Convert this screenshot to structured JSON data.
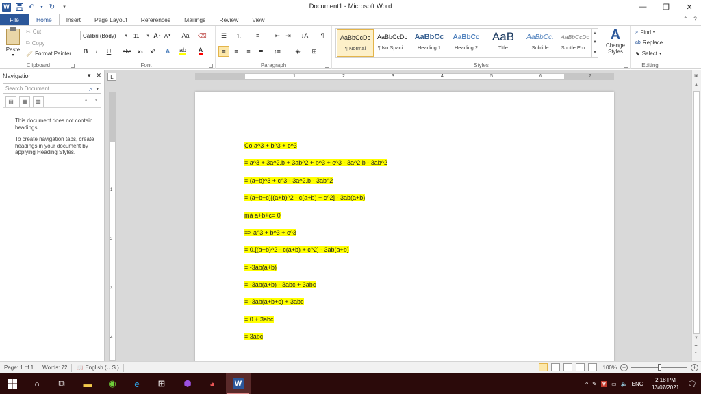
{
  "window": {
    "title": "Document1 - Microsoft Word"
  },
  "tabs": [
    "File",
    "Home",
    "Insert",
    "Page Layout",
    "References",
    "Mailings",
    "Review",
    "View"
  ],
  "ribbon": {
    "clipboard": {
      "label": "Clipboard",
      "paste": "Paste",
      "cut": "Cut",
      "copy": "Copy",
      "format_painter": "Format Painter"
    },
    "font": {
      "label": "Font",
      "font_name": "Calibri (Body)",
      "font_size": "11",
      "grow": "A",
      "shrink": "A",
      "case": "Aa",
      "bold": "B",
      "italic": "I",
      "underline": "U",
      "strike": "abc",
      "sub": "x₂",
      "sup": "x²",
      "color_a": "A"
    },
    "paragraph": {
      "label": "Paragraph",
      "pilcrow": "¶"
    },
    "styles": {
      "label": "Styles",
      "items": [
        {
          "preview": "AaBbCcDc",
          "name": "¶ Normal"
        },
        {
          "preview": "AaBbCcDc",
          "name": "¶ No Spaci..."
        },
        {
          "preview": "AaBbCc",
          "name": "Heading 1"
        },
        {
          "preview": "AaBbCc",
          "name": "Heading 2"
        },
        {
          "preview": "AaB",
          "name": "Title"
        },
        {
          "preview": "AaBbCc.",
          "name": "Subtitle"
        },
        {
          "preview": "AaBbCcDc",
          "name": "Subtle Em..."
        }
      ],
      "change_styles": "Change Styles"
    },
    "editing": {
      "label": "Editing",
      "find": "Find",
      "replace": "Replace",
      "select": "Select"
    }
  },
  "nav": {
    "title": "Navigation",
    "search_placeholder": "Search Document",
    "msg1": "This document does not contain headings.",
    "msg2": "To create navigation tabs, create headings in your document by applying Heading Styles."
  },
  "ruler": {
    "h_numbers": [
      "1",
      "2",
      "3",
      "4",
      "5",
      "6",
      "7"
    ],
    "v_numbers": [
      "1",
      "2",
      "3",
      "4"
    ]
  },
  "document": {
    "lines": [
      "Có a^3 + b^3 + c^3",
      "= a^3 + 3a^2.b + 3ab^2 + b^3 + c^3 - 3a^2.b - 3ab^2",
      "= (a+b)^3 + c^3 - 3a^2.b - 3ab^2",
      "= (a+b+c)[(a+b)^2 - c(a+b) + c^2] - 3ab(a+b)",
      "mà a+b+c= 0",
      "=> a^3 + b^3 + c^3",
      "= 0.[(a+b)^2 - c(a+b) + c^2] - 3ab(a+b)",
      "= -3ab(a+b)",
      "= -3ab(a+b) - 3abc + 3abc",
      "= -3ab(a+b+c) + 3abc",
      "= 0 + 3abc",
      "= 3abc"
    ],
    "highlight_color": "#ffff00"
  },
  "status": {
    "page": "Page: 1 of 1",
    "words": "Words: 72",
    "language": "English (U.S.)",
    "zoom": "100%",
    "zoom_level": 1.0
  },
  "taskbar": {
    "lang": "ENG",
    "time": "2:18 PM",
    "date": "13/07/2021"
  },
  "colors": {
    "accent": "#2b579a",
    "taskbar": "#2b0a0a"
  }
}
